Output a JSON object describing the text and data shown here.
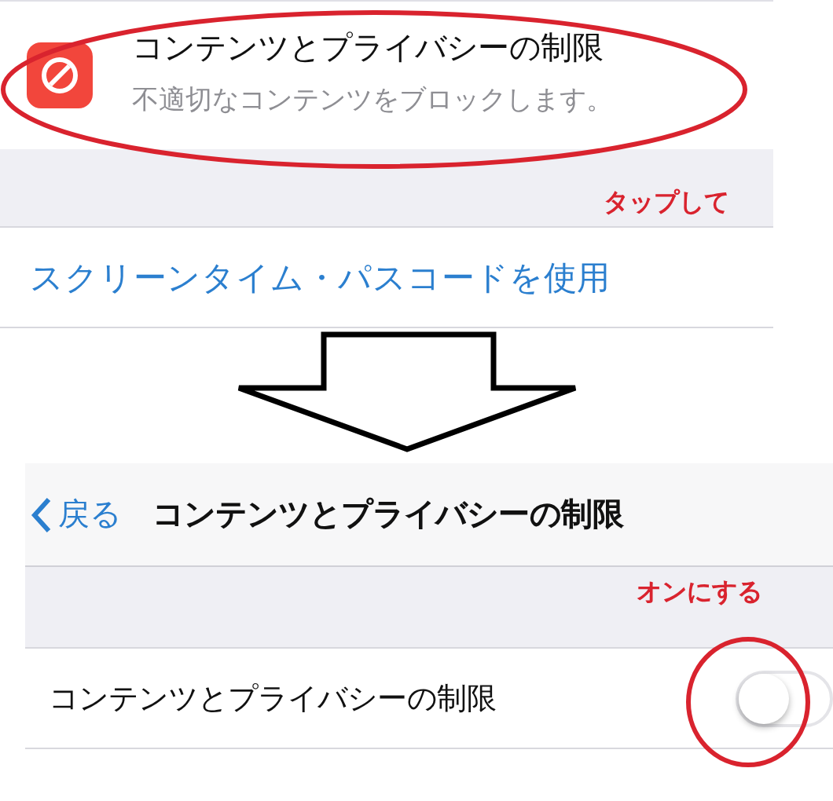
{
  "top_screen": {
    "row": {
      "title": "コンテンツとプライバシーの制限",
      "subtitle": "不適切なコンテンツをブロックします。"
    },
    "link": "スクリーンタイム・パスコードを使用"
  },
  "top_note": "タップして",
  "bottom_screen": {
    "nav": {
      "back": "戻る",
      "title": "コンテンツとプライバシーの制限"
    },
    "row": {
      "label": "コンテンツとプライバシーの制限",
      "on": false
    }
  },
  "bottom_note": "オンにする"
}
